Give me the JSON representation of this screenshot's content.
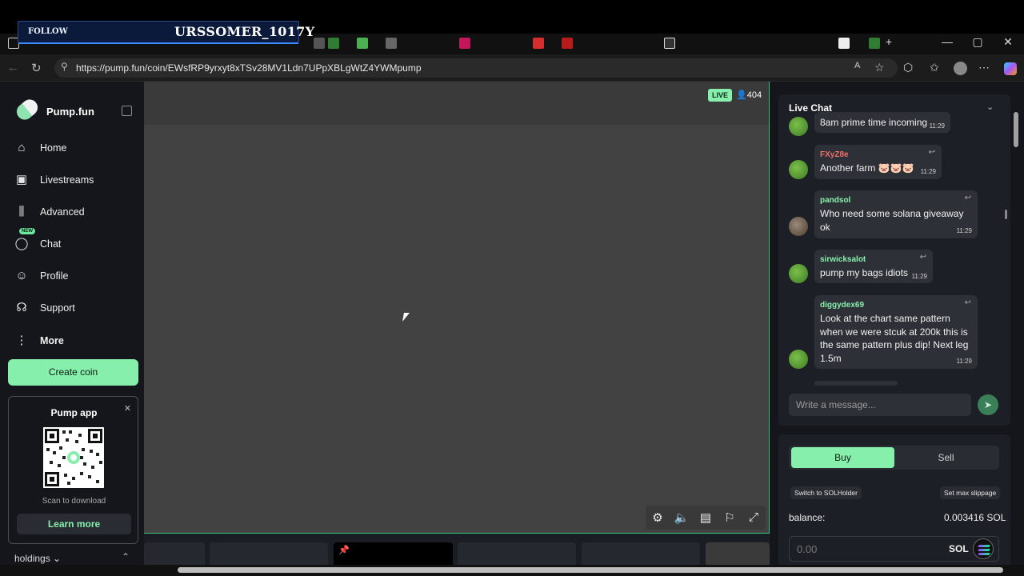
{
  "overlay": {
    "follow": "FOLLOW",
    "streamer": "URSSOMER_1017Y"
  },
  "browser": {
    "url": "https://pump.fun/coin/EWsfRP9yrxyt8xTSv28MV1Ldn7UPpXBLgWtZ4YWMpump",
    "new_tab": "+",
    "minimize": "—",
    "maximize": "▢",
    "close": "✕"
  },
  "sidebar": {
    "brand": "Pump.fun",
    "items": [
      {
        "label": "Home",
        "icon": "home-icon"
      },
      {
        "label": "Livestreams",
        "icon": "video-camera-icon"
      },
      {
        "label": "Advanced",
        "icon": "candlestick-icon"
      },
      {
        "label": "Chat",
        "icon": "chat-bubble-icon",
        "badge": "NEW"
      },
      {
        "label": "Profile",
        "icon": "user-circle-icon"
      },
      {
        "label": "Support",
        "icon": "headset-icon"
      },
      {
        "label": "More",
        "icon": "more-vertical-icon"
      }
    ],
    "create_coin": "Create coin",
    "app_card": {
      "title": "Pump app",
      "scan": "Scan to download",
      "learn_more": "Learn more"
    },
    "holdings": "holdings"
  },
  "player": {
    "live": "LIVE",
    "viewers": "404"
  },
  "chat": {
    "title": "Live Chat",
    "messages": [
      {
        "user": "",
        "text": "8am prime time incoming",
        "time": "11:29",
        "color": "#86efac"
      },
      {
        "user": "FXyZ8e",
        "text": "Another farm 🐷🐷🐷",
        "time": "11:29",
        "color": "#f07167"
      },
      {
        "user": "pandsol",
        "text": "Who need some solana giveaway ok",
        "time": "11:29",
        "color": "#86efac"
      },
      {
        "user": "sirwicksalot",
        "text": "pump my bags idiots",
        "time": "11:29",
        "color": "#86efac"
      },
      {
        "user": "diggydex69",
        "text": "Look at the chart same pattern when we were stcuk at 200k this is the same pattern plus dip! Next leg 1.5m",
        "time": "11:29",
        "color": "#86efac"
      }
    ],
    "input_placeholder": "Write a message..."
  },
  "trade": {
    "buy": "Buy",
    "sell": "Sell",
    "switch": "Switch to SOLHolder",
    "slippage": "Set max slippage",
    "balance_label": "balance:",
    "balance_value": "0.003416 SOL",
    "amount_placeholder": "0.00",
    "unit": "SOL"
  },
  "colors": {
    "accent": "#86efac",
    "panel": "#1d1f26",
    "sidebar": "#15161b"
  }
}
